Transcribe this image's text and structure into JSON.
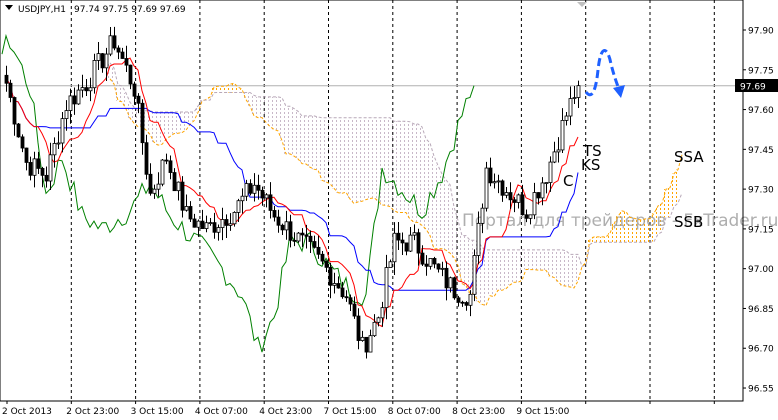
{
  "chart_data": {
    "type": "candlestick",
    "symbol_header": "USDJPY,H1",
    "ohlc_header": "97.74 97.75 97.69 97.69",
    "current_price": "97.69",
    "ylim": [
      96.5,
      98.0
    ],
    "y_ticks": [
      "97.90",
      "97.75",
      "97.60",
      "97.45",
      "97.30",
      "97.15",
      "97.00",
      "96.85",
      "96.70",
      "96.55"
    ],
    "y_tick_values": [
      97.9,
      97.75,
      97.6,
      97.45,
      97.3,
      97.15,
      97.0,
      96.85,
      96.7,
      96.55
    ],
    "x_ticks": [
      "2 Oct 2013",
      "2 Oct 23:00",
      "3 Oct 15:00",
      "4 Oct 07:00",
      "4 Oct 23:00",
      "7 Oct 15:00",
      "8 Oct 07:00",
      "8 Oct 23:00",
      "9 Oct 15:00"
    ],
    "bars_per_tick": 16,
    "bar_count": 144,
    "price_path": [
      [
        0,
        97.7
      ],
      [
        5,
        97.4
      ],
      [
        10,
        97.35
      ],
      [
        15,
        97.62
      ],
      [
        20,
        97.7
      ],
      [
        27,
        97.86
      ],
      [
        32,
        97.68
      ],
      [
        36,
        97.28
      ],
      [
        40,
        97.42
      ],
      [
        45,
        97.2
      ],
      [
        50,
        97.15
      ],
      [
        57,
        97.22
      ],
      [
        62,
        97.32
      ],
      [
        67,
        97.2
      ],
      [
        75,
        97.08
      ],
      [
        80,
        97.0
      ],
      [
        85,
        96.9
      ],
      [
        89,
        96.7
      ],
      [
        93,
        96.82
      ],
      [
        97,
        97.1
      ],
      [
        102,
        97.1
      ],
      [
        107,
        97.0
      ],
      [
        112,
        96.92
      ],
      [
        116,
        96.9
      ],
      [
        120,
        97.38
      ],
      [
        125,
        97.3
      ],
      [
        130,
        97.22
      ],
      [
        135,
        97.36
      ],
      [
        140,
        97.58
      ],
      [
        143,
        97.7
      ]
    ],
    "indicators": {
      "ichimoku": {
        "tenkan": 9,
        "kijun": 26,
        "senkou_b": 52
      },
      "labels": {
        "ts": "TS",
        "ks": "KS",
        "chikou": "C",
        "ssa": "SSA",
        "ssb": "SSB"
      }
    },
    "colors": {
      "tenkan": "#ff0000",
      "kijun": "#0000ff",
      "chikou": "#008000",
      "ssa": "#ffa500",
      "ssb": "#c0b0c0",
      "forecast": "#1e60ff"
    },
    "watermark": "Портал для трейдеров - FxTrader.ru"
  }
}
